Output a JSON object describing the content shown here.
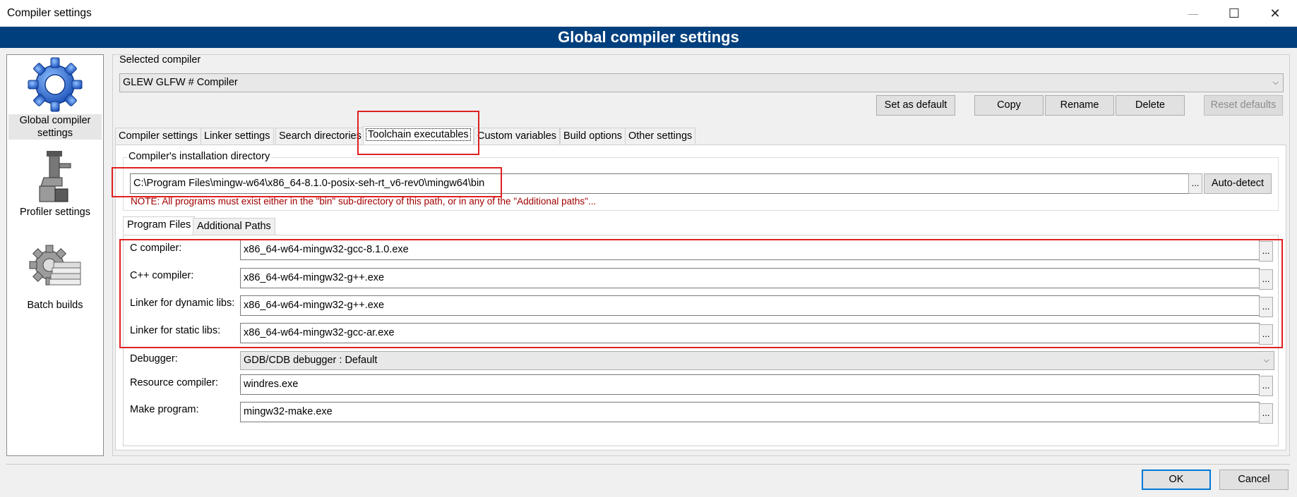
{
  "window": {
    "title": "Compiler settings",
    "minimize_glyph": "—",
    "maximize_glyph": "☐",
    "close_glyph": "✕"
  },
  "banner": {
    "title": "Global compiler settings"
  },
  "sidebar": {
    "items": [
      {
        "label": "Global compiler settings",
        "icon": "gear-icon"
      },
      {
        "label": "Profiler settings",
        "icon": "microscope-icon"
      },
      {
        "label": "Batch builds",
        "icon": "batch-gear-icon"
      }
    ]
  },
  "selected_compiler": {
    "group_label": "Selected compiler",
    "value": "GLEW GLFW # Compiler"
  },
  "compiler_buttons": {
    "set_default": "Set as default",
    "copy": "Copy",
    "rename": "Rename",
    "delete": "Delete",
    "reset_defaults": "Reset defaults"
  },
  "tabs": [
    "Compiler settings",
    "Linker settings",
    "Search directories",
    "Toolchain executables",
    "Custom variables",
    "Build options",
    "Other settings"
  ],
  "install_dir": {
    "group_label": "Compiler's installation directory",
    "value": "C:\\Program Files\\mingw-w64\\x86_64-8.1.0-posix-seh-rt_v6-rev0\\mingw64\\bin",
    "browse": "...",
    "auto_detect": "Auto-detect",
    "note": "NOTE: All programs must exist either in the \"bin\" sub-directory of this path, or in any of the \"Additional paths\"..."
  },
  "subtabs": [
    "Program Files",
    "Additional Paths"
  ],
  "programs": {
    "c_compiler": {
      "label": "C compiler:",
      "value": "x86_64-w64-mingw32-gcc-8.1.0.exe"
    },
    "cpp_compiler": {
      "label": "C++ compiler:",
      "value": "x86_64-w64-mingw32-g++.exe"
    },
    "linker_dynamic": {
      "label": "Linker for dynamic libs:",
      "value": "x86_64-w64-mingw32-g++.exe"
    },
    "linker_static": {
      "label": "Linker for static libs:",
      "value": "x86_64-w64-mingw32-gcc-ar.exe"
    },
    "debugger": {
      "label": "Debugger:",
      "value": "GDB/CDB debugger : Default"
    },
    "resource_compiler": {
      "label": "Resource compiler:",
      "value": "windres.exe"
    },
    "make_program": {
      "label": "Make program:",
      "value": "mingw32-make.exe"
    },
    "browse": "..."
  },
  "footer": {
    "ok": "OK",
    "cancel": "Cancel"
  },
  "colors": {
    "banner_bg": "#003f7d",
    "highlight_red": "#e02020",
    "note_text": "#a00000"
  }
}
